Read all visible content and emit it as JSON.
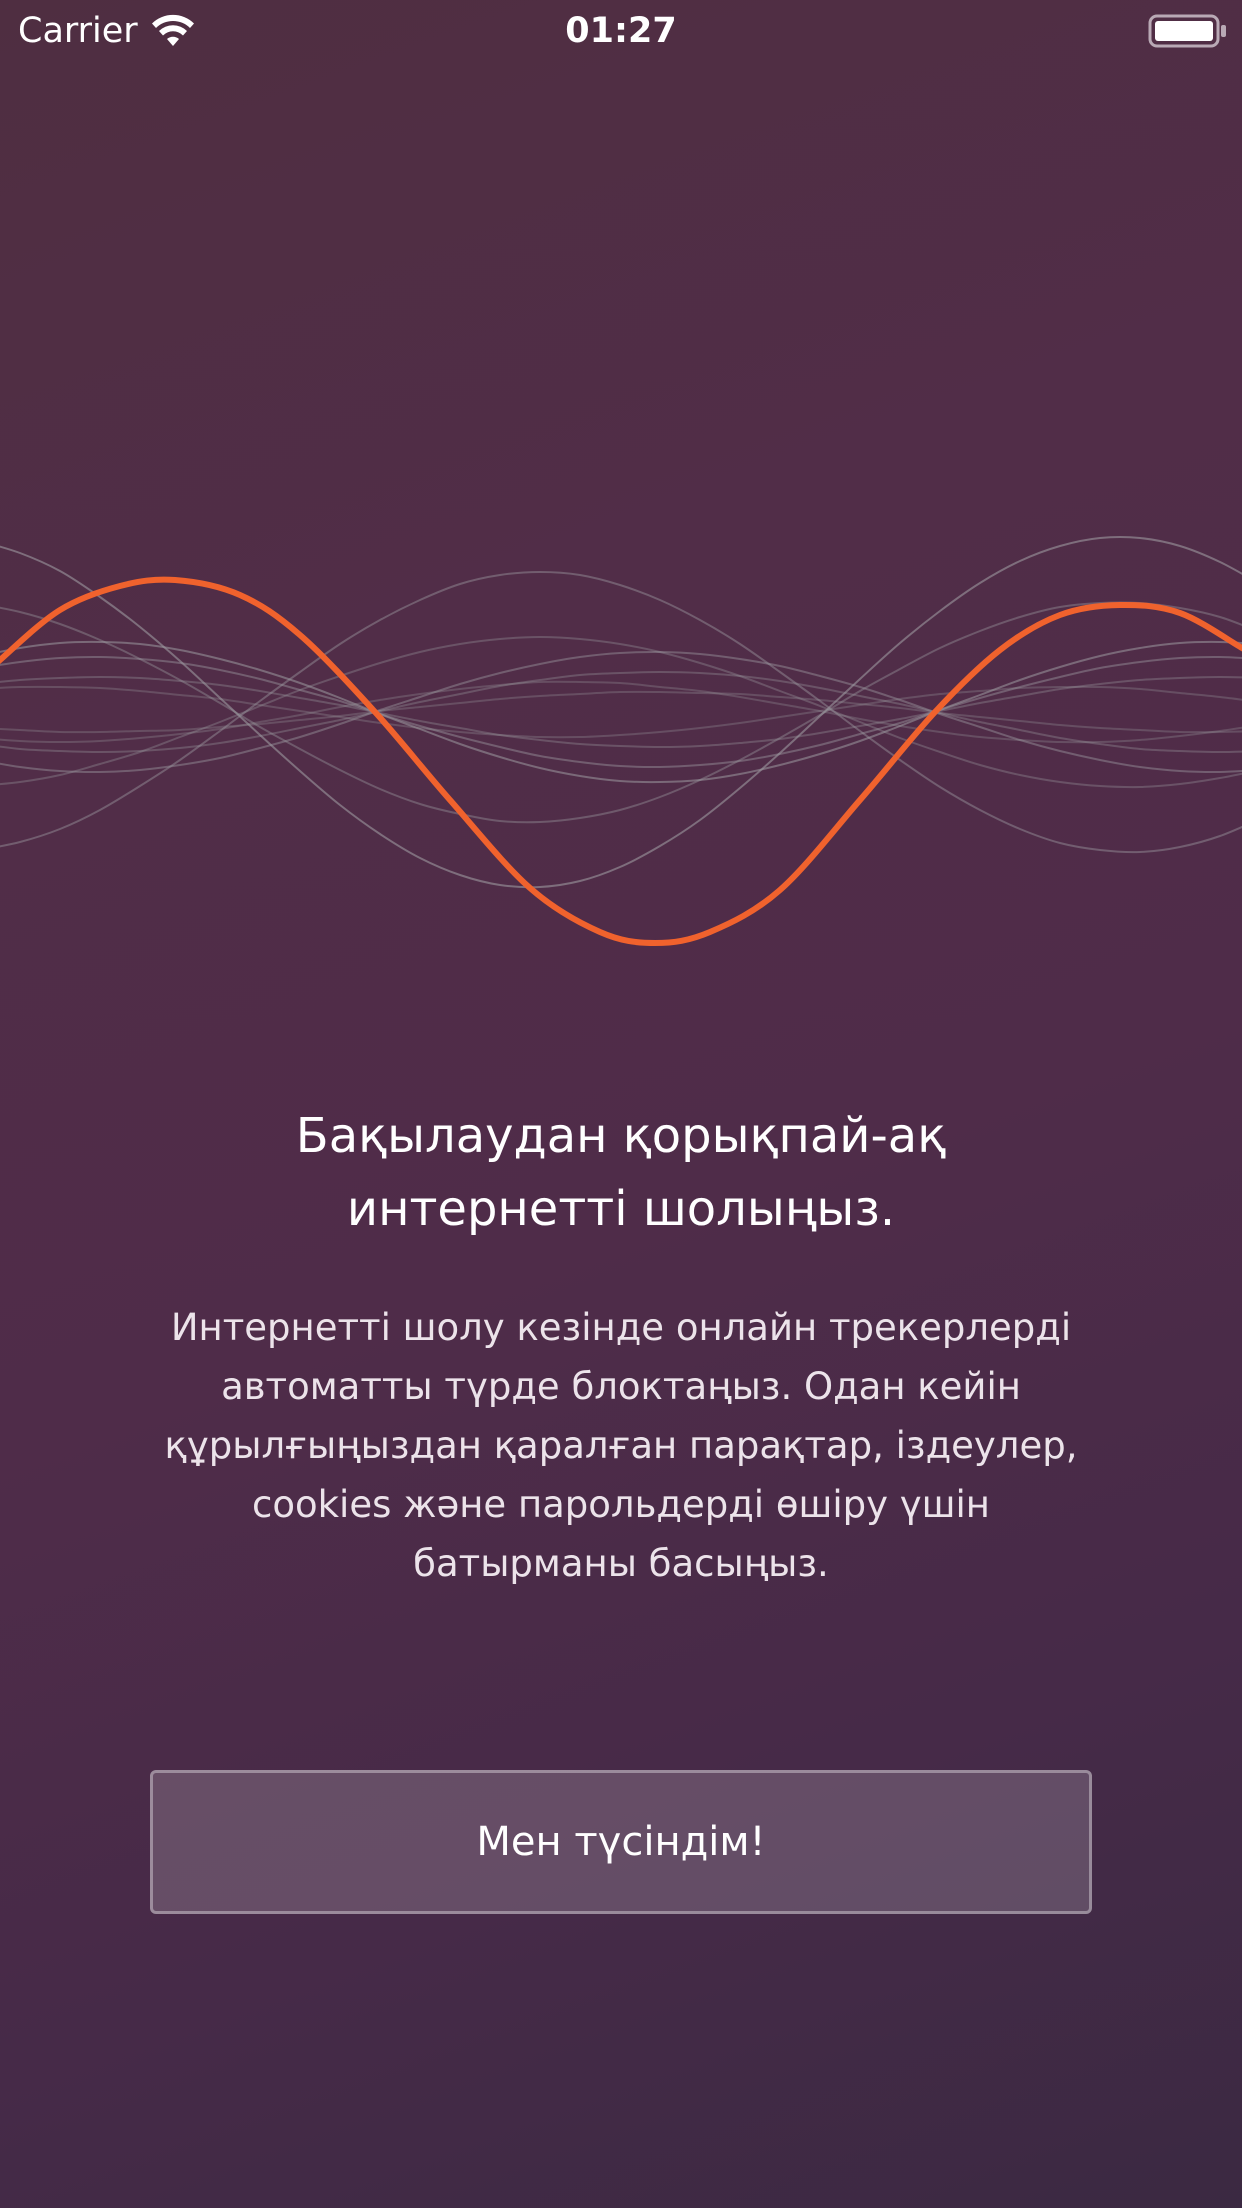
{
  "status_bar": {
    "carrier": "Carrier",
    "time": "01:27",
    "wifi_icon": "wifi-icon",
    "battery_icon": "battery-icon"
  },
  "illustration": {
    "icon": "sound-wave-illustration",
    "accent_color": "#f0622d",
    "line_color": "#9c9aa0"
  },
  "onboarding": {
    "title_line1": "Бақылаудан қорықпай-ақ",
    "title_line2": "интернетті шолыңыз.",
    "description_lines": [
      "Интернетті шолу кезінде онлайн трекерлерді",
      "автоматты түрде блоктаңыз. Одан кейін",
      "құрылғыңыздан қаралған парақтар, іздеулер,",
      "cookies және парольдерді өшіру үшін",
      "батырманы басыңыз."
    ],
    "button_label": "Мен түсіндім!"
  },
  "colors": {
    "background_start": "#4f2e41",
    "background_end": "#3b2942",
    "accent": "#f0622d"
  }
}
